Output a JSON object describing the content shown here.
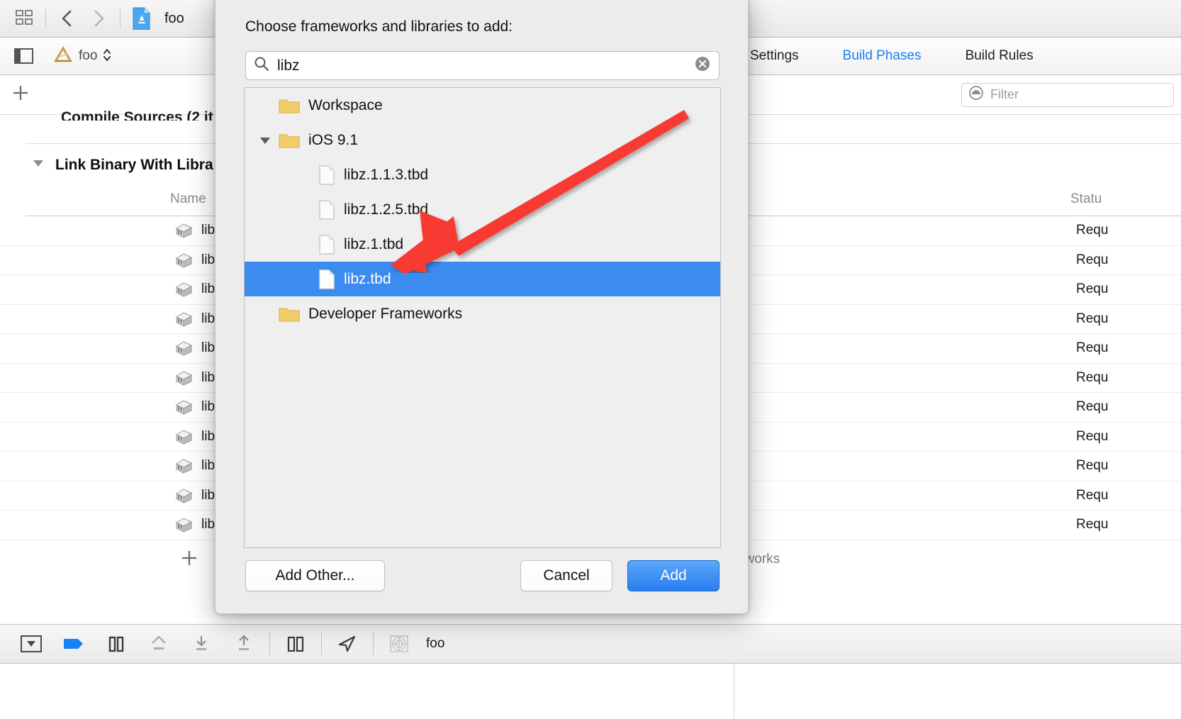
{
  "toolbar": {
    "grid_icon": "grid-view-icon",
    "back_icon": "back-chevron-icon",
    "forward_icon": "forward-chevron-icon",
    "project_icon": "app-document-icon",
    "project_name": "foo"
  },
  "jumpbar": {
    "pane_toggle_icon": "navigator-pane-toggle-icon",
    "target_icon": "xcode-target-icon",
    "target_name": "foo",
    "stepper_icon": "up-down-chevron-icon"
  },
  "editor_tabs": [
    {
      "label": "Settings",
      "active": false
    },
    {
      "label": "Build Phases",
      "active": true
    },
    {
      "label": "Build Rules",
      "active": false
    }
  ],
  "filter": {
    "icon": "filter-round-icon",
    "placeholder": "Filter"
  },
  "add_phase": {
    "icon": "plus-icon"
  },
  "phases": {
    "clipped_phase_label": "Compile Sources (2 it",
    "disclosure_icon": "disclosure-triangle-down-icon",
    "link_phase_label": "Link Binary With Libra",
    "columns": {
      "name": "Name",
      "status": "Statu"
    },
    "rows": [
      {
        "icon": "library-icon",
        "name": "lib",
        "status": "Requ"
      },
      {
        "icon": "library-icon",
        "name": "lib",
        "status": "Requ"
      },
      {
        "icon": "library-icon",
        "name": "lib",
        "status": "Requ"
      },
      {
        "icon": "library-icon",
        "name": "lib",
        "status": "Requ"
      },
      {
        "icon": "library-icon",
        "name": "lib",
        "status": "Requ"
      },
      {
        "icon": "library-icon",
        "name": "lib",
        "status": "Requ"
      },
      {
        "icon": "library-icon",
        "name": "lib",
        "status": "Requ"
      },
      {
        "icon": "library-icon",
        "name": "lib",
        "status": "Requ"
      },
      {
        "icon": "library-icon",
        "name": "lib",
        "status": "Requ"
      },
      {
        "icon": "library-icon",
        "name": "lib",
        "status": "Requ"
      },
      {
        "icon": "library-icon",
        "name": "lib",
        "status": "Requ"
      }
    ],
    "footer_add_icon": "plus-icon",
    "footer_note": "eworks"
  },
  "debug_toolbar": {
    "items": [
      {
        "icon": "hide-debug-area-icon"
      },
      {
        "icon": "breakpoint-icon"
      },
      {
        "icon": "pause-icon"
      },
      {
        "icon": "step-over-icon"
      },
      {
        "icon": "step-into-icon"
      },
      {
        "icon": "step-out-icon"
      },
      {
        "icon": "split-console-icon"
      },
      {
        "icon": "location-simulate-icon"
      },
      {
        "icon": "view-hierarchy-icon"
      }
    ],
    "stack_label": "foo"
  },
  "dialog": {
    "title": "Choose frameworks and libraries to add:",
    "search": {
      "icon": "search-icon",
      "value": "libz",
      "placeholder": "",
      "clear_icon": "clear-circle-icon"
    },
    "tree": [
      {
        "label": "Workspace",
        "type": "folder",
        "icon": "folder-icon",
        "indent": 0,
        "expanded": null,
        "selected": false
      },
      {
        "label": "iOS 9.1",
        "type": "folder",
        "icon": "folder-icon",
        "indent": 0,
        "expanded": true,
        "selected": false
      },
      {
        "label": "libz.1.1.3.tbd",
        "type": "file",
        "icon": "file-icon",
        "indent": 1,
        "expanded": null,
        "selected": false
      },
      {
        "label": "libz.1.2.5.tbd",
        "type": "file",
        "icon": "file-icon",
        "indent": 1,
        "expanded": null,
        "selected": false
      },
      {
        "label": "libz.1.tbd",
        "type": "file",
        "icon": "file-icon",
        "indent": 1,
        "expanded": null,
        "selected": false
      },
      {
        "label": "libz.tbd",
        "type": "file",
        "icon": "file-icon",
        "indent": 1,
        "expanded": null,
        "selected": true
      },
      {
        "label": "Developer Frameworks",
        "type": "folder",
        "icon": "folder-icon",
        "indent": 0,
        "expanded": null,
        "selected": false
      }
    ],
    "buttons": {
      "add_other": "Add Other...",
      "cancel": "Cancel",
      "add": "Add"
    }
  },
  "annotation": {
    "arrow_icon": "red-arrow-annotation",
    "color": "#f83a30"
  },
  "colors": {
    "selection_blue": "#3c8cf0",
    "accent_blue": "#1a7ef4",
    "default_button_blue": "#2a7ef0",
    "sheet_bg": "#ececec",
    "annotation_red": "#f83a30"
  }
}
